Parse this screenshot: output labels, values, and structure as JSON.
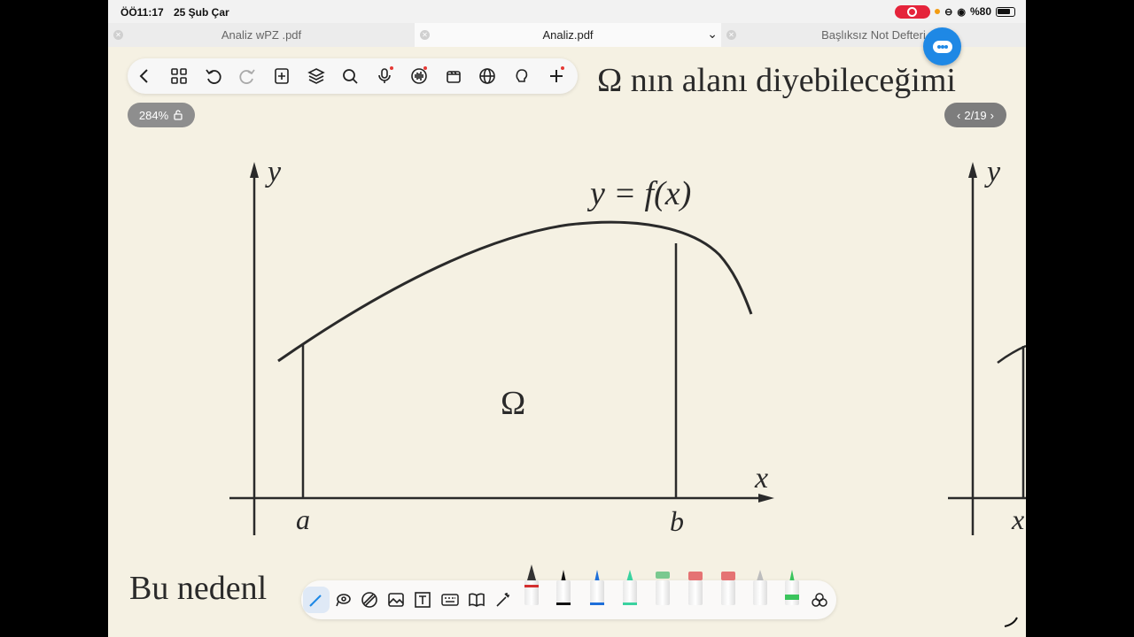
{
  "status_bar": {
    "time": "ÖÖ11:17",
    "date": "25 Şub Çar",
    "battery": "%80",
    "recording_color": "#e5243b"
  },
  "tabs": [
    {
      "label": "Analiz wPZ .pdf",
      "active": false
    },
    {
      "label": "Analiz.pdf",
      "active": true
    },
    {
      "label": "Başlıksız Not Defteri",
      "active": false
    }
  ],
  "document": {
    "heading_text": "Ω nın alanı diyebileceğimi",
    "bottom_text": "Bu nedenl",
    "zoom": "284%",
    "page_indicator": "2/19",
    "graph": {
      "curve_label": "y = f(x)",
      "region_label": "Ω",
      "x_axis": "x",
      "y_axis": "y",
      "left_bound": "a",
      "right_bound": "b",
      "side_x_label": "x",
      "side_y_label": "y"
    }
  },
  "toolbar_top": [
    {
      "name": "back-icon"
    },
    {
      "name": "grid-icon"
    },
    {
      "name": "undo-icon"
    },
    {
      "name": "redo-icon"
    },
    {
      "name": "add-page-icon"
    },
    {
      "name": "layers-icon"
    },
    {
      "name": "search-icon"
    },
    {
      "name": "microphone-icon",
      "badge": true
    },
    {
      "name": "audio-wave-icon",
      "badge": true
    },
    {
      "name": "record-icon"
    },
    {
      "name": "globe-icon"
    },
    {
      "name": "bulb-icon"
    },
    {
      "name": "add-icon",
      "badge": true
    }
  ],
  "toolbar_bottom": [
    "pen-tool-icon",
    "lasso-icon",
    "shape-icon",
    "image-icon",
    "text-box-icon",
    "keyboard-icon",
    "book-icon",
    "magic-wand-icon",
    "fountain-pen-icon",
    "black-marker-icon",
    "blue-pen-icon",
    "green-highlighter-icon",
    "eraser-icon",
    "red-eraser-icon",
    "red-eraser-2-icon",
    "pencil-icon",
    "green-pen-icon",
    "color-palette-icon"
  ],
  "colors": {
    "accent_blue": "#1e88e5",
    "page_bg": "#f5f1e3",
    "ink": "#2a2a2a"
  }
}
